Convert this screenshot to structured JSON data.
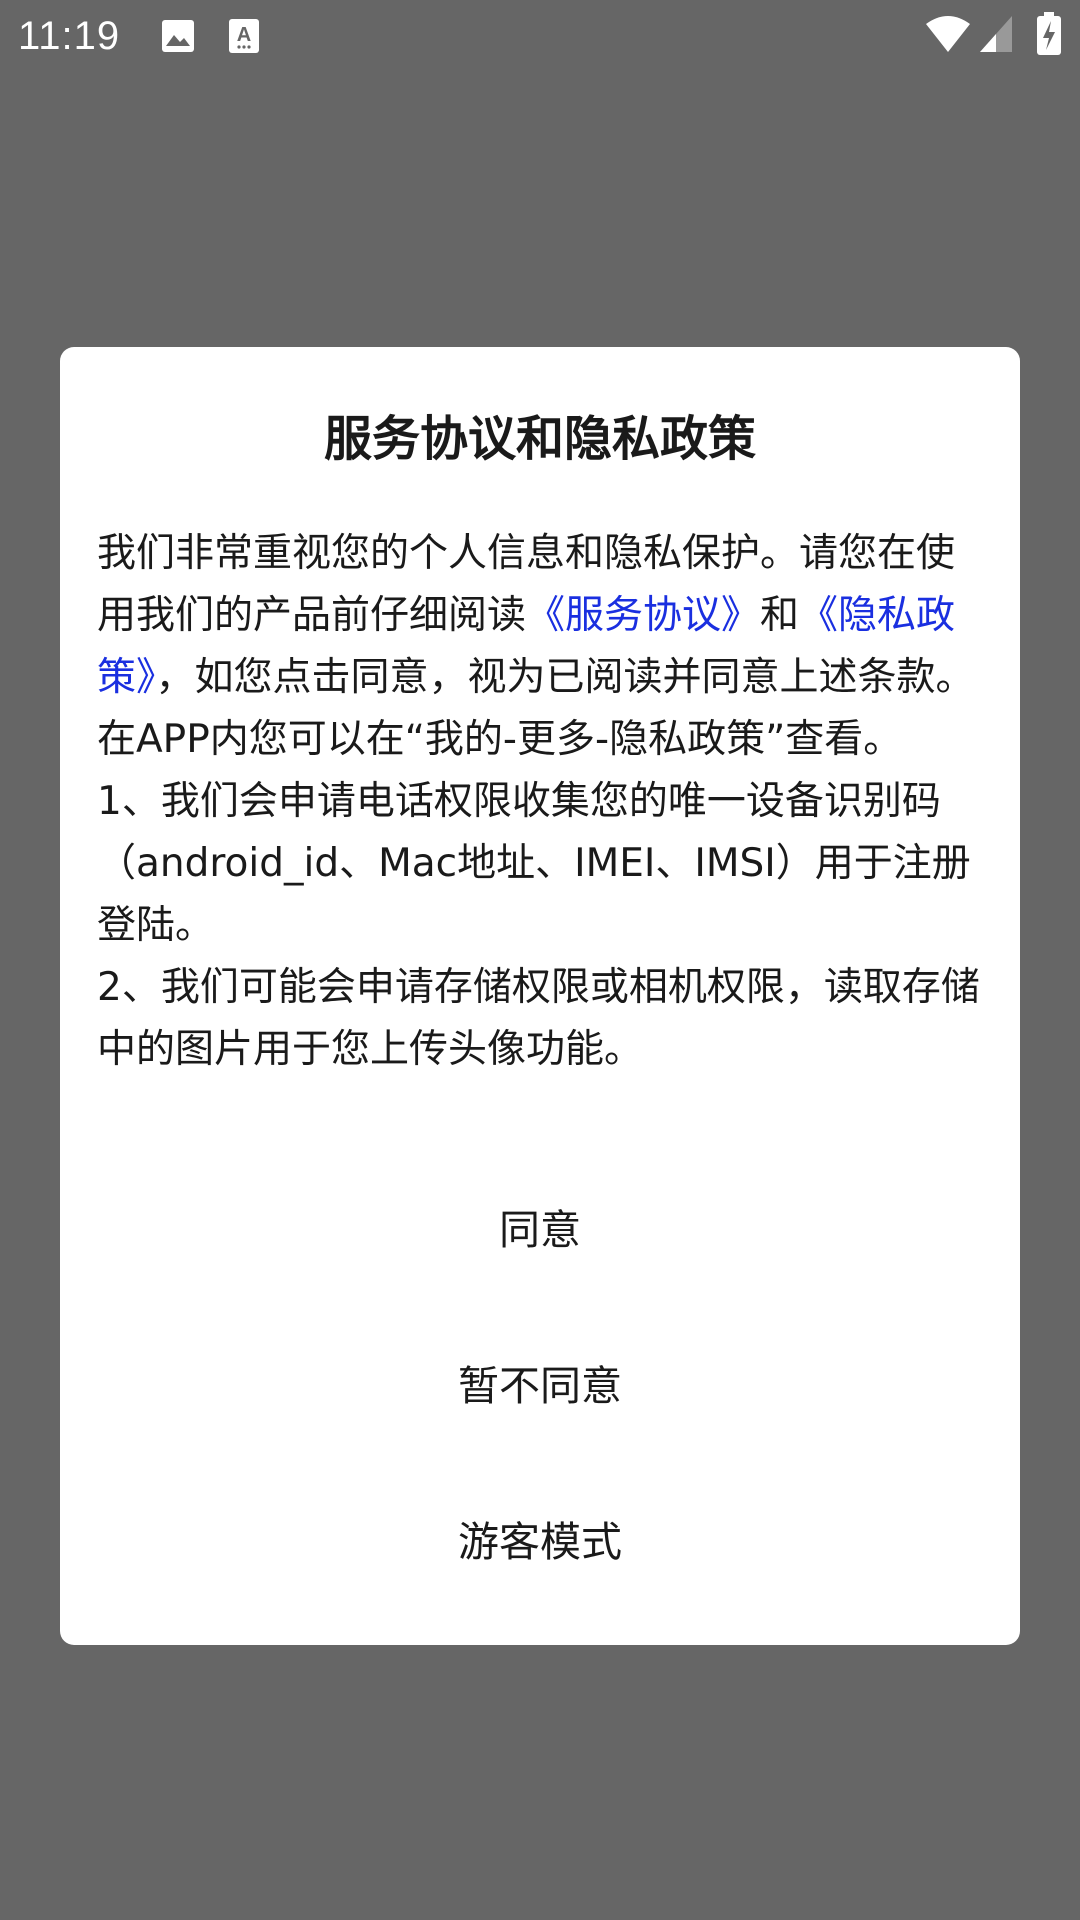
{
  "status_bar": {
    "time": "11:19",
    "icons": [
      "image-icon",
      "text-a-icon",
      "wifi-icon",
      "signal-icon",
      "battery-charging-icon"
    ]
  },
  "dialog": {
    "title": "服务协议和隐私政策",
    "body": {
      "p1_text_a": "我们非常重视您的个人信息和隐私保护。请您在使用我们的产品前仔细阅读",
      "service_link": "《服务协议》",
      "p1_text_b": "和",
      "privacy_link": "《隐私政策》",
      "p1_text_c": "，如您点击同意，视为已阅读并同意上述条款。 在APP内您可以在“我的-更多-隐私政策”查看。",
      "p2": "1、我们会申请电话权限收集您的唯一设备识别码（android_id、Mac地址、IMEI、IMSI）用于注册登陆。",
      "p3": "2、我们可能会申请存储权限或相机权限，读取存储中的图片用于您上传头像功能。"
    },
    "buttons": {
      "agree": "同意",
      "disagree": "暂不同意",
      "guest": "游客模式"
    }
  },
  "colors": {
    "overlay": "#666666",
    "dialog_bg": "#ffffff",
    "link": "#1a2fe0",
    "text": "#1a1a1a"
  }
}
